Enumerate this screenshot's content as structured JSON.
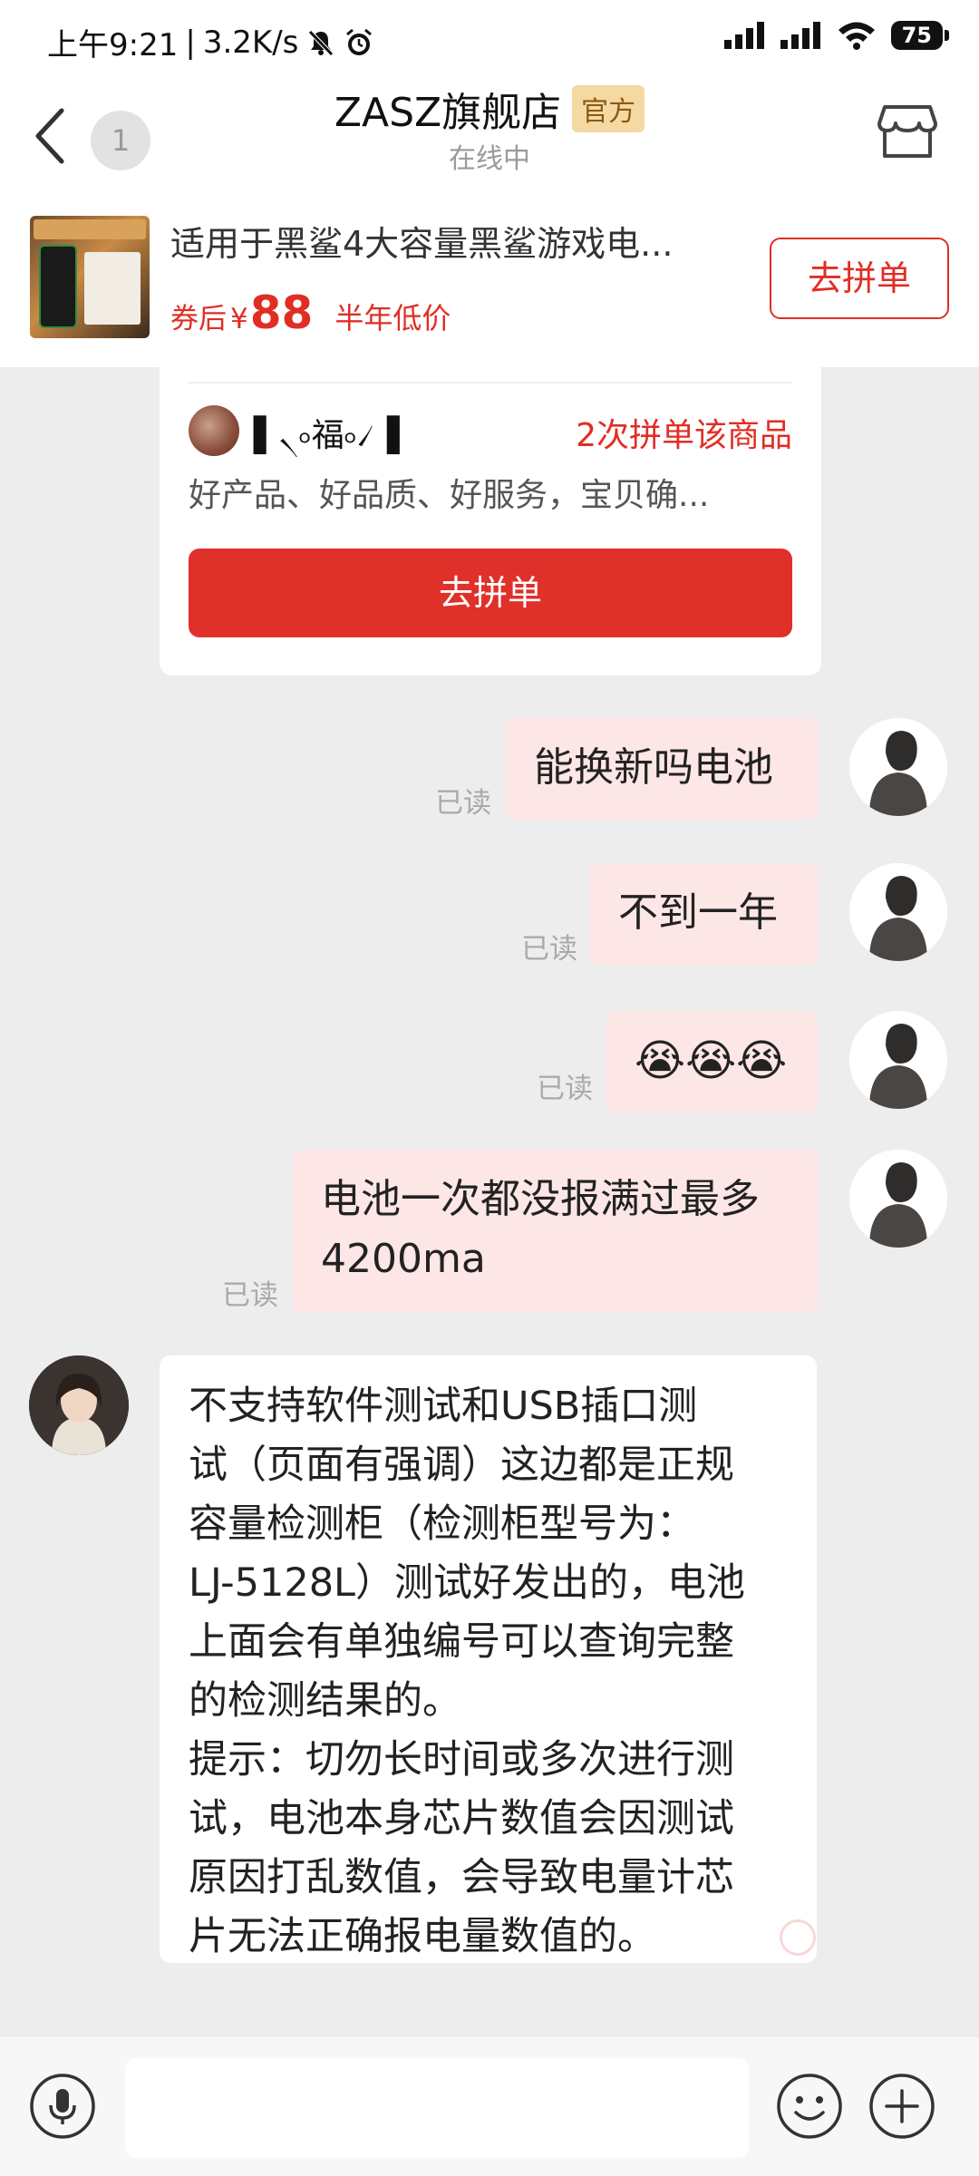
{
  "status_bar": {
    "time": "上午9:21",
    "network_speed": "3.2K/s",
    "battery": "75",
    "icons": [
      "mute-icon",
      "alarm-icon",
      "signal-icon",
      "signal-icon",
      "wifi-icon",
      "battery-icon"
    ]
  },
  "header": {
    "unread_count": "1",
    "shop_name": "ZASZ旗舰店",
    "official_badge": "官方",
    "online_status": "在线中"
  },
  "product": {
    "title": "适用于黑鲨4大容量黑鲨游戏电...",
    "coupon_label": "券后",
    "currency": "¥",
    "price": "88",
    "low_price_tag": "半年低价",
    "button": "去拼单"
  },
  "group_card": {
    "buyer_name": "▌৲৹福৹৴▐",
    "buy_count": "2次拼单该商品",
    "review": "好产品、好品质、好服务，宝贝确...",
    "button": "去拼单"
  },
  "messages": [
    {
      "side": "out",
      "text": "能换新吗电池",
      "read": "已读"
    },
    {
      "side": "out",
      "text": "不到一年",
      "read": "已读"
    },
    {
      "side": "out",
      "text": "😭😭😭",
      "read": "已读"
    },
    {
      "side": "out",
      "text": "电池一次都没报满过最多\n4200ma",
      "read": "已读"
    },
    {
      "side": "in",
      "text": "不支持软件测试和USB插口测\n试（页面有强调）这边都是正规\n容量检测柜（检测柜型号为：\nLJ-5128L）测试好发出的，电池\n上面会有单独编号可以查询完整\n的检测结果的。\n提示：切勿长时间或多次进行测\n试，电池本身芯片数值会因测试\n原因打乱数值，会导致电量计芯\n片无法正确报电量数值的。"
    }
  ],
  "colors": {
    "accent": "#e02e24",
    "outgoing_bubble": "#fde6e6",
    "chat_background": "#ededed"
  }
}
